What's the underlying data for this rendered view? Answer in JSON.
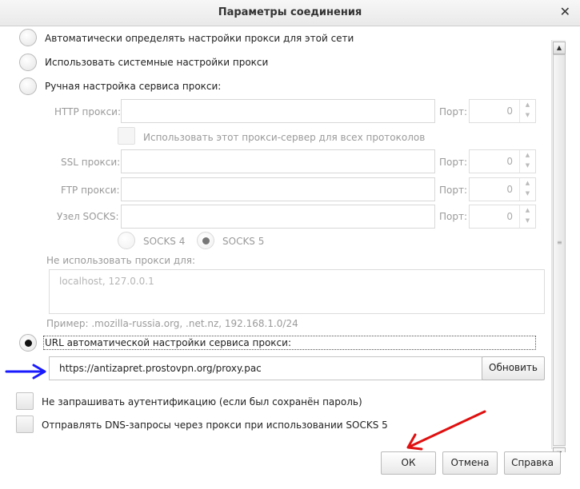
{
  "window": {
    "title": "Параметры соединения"
  },
  "options": {
    "auto_detect": "Автоматически определять настройки прокси для этой сети",
    "system": "Использовать системные настройки прокси",
    "manual": "Ручная настройка сервиса прокси:",
    "auto_url": "URL автоматической настройки сервиса прокси:"
  },
  "manual": {
    "http_label": "HTTP прокси:",
    "ssl_label": "SSL прокси:",
    "ftp_label": "FTP прокси:",
    "socks_label": "Узел SOCKS:",
    "port_label": "Порт:",
    "http_port": "0",
    "ssl_port": "0",
    "ftp_port": "0",
    "socks_port": "0",
    "share_all": "Использовать этот прокси-сервер для всех протоколов",
    "socks4": "SOCKS 4",
    "socks5": "SOCKS 5",
    "no_proxy_label": "Не использовать прокси для:",
    "no_proxy_value": "localhost, 127.0.0.1",
    "example": "Пример: .mozilla-russia.org, .net.nz, 192.168.1.0/24"
  },
  "auto": {
    "url": "https://antizapret.prostovpn.org/proxy.pac",
    "reload": "Обновить"
  },
  "checks": {
    "no_auth": "Не запрашивать аутентификацию (если был сохранён пароль)",
    "dns": "Отправлять DNS-запросы через прокси при использовании SOCKS 5"
  },
  "buttons": {
    "ok": "ОК",
    "cancel": "Отмена",
    "help": "Справка"
  },
  "colors": {
    "annotation_blue": "#1a1aff",
    "annotation_red": "#e01010"
  }
}
